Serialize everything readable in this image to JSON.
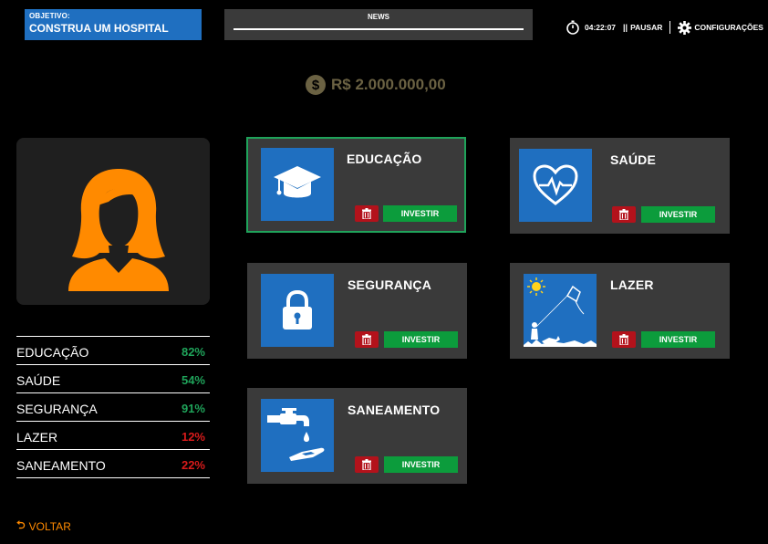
{
  "header": {
    "objective_label": "OBJETIVO:",
    "objective_value": "CONSTRUA UM HOSPITAL",
    "news_label": "NEWS",
    "timer": "04:22:07",
    "pause_label": "PAUSAR",
    "settings_label": "CONFIGURAÇÕES"
  },
  "money": {
    "amount": "R$ 2.000.000,00"
  },
  "stats": [
    {
      "label": "EDUCAÇÃO",
      "value": "82%",
      "color": "#1fa35a"
    },
    {
      "label": "SAÚDE",
      "value": "54%",
      "color": "#1fa35a"
    },
    {
      "label": "SEGURANÇA",
      "value": "91%",
      "color": "#1fa35a"
    },
    {
      "label": "LAZER",
      "value": "12%",
      "color": "#d81b1b"
    },
    {
      "label": "SANEAMENTO",
      "value": "22%",
      "color": "#d81b1b"
    }
  ],
  "back_label": "VOLTAR",
  "cards": [
    {
      "title": "EDUCAÇÃO",
      "icon": "graduation-cap-icon",
      "invest_label": "INVESTIR",
      "selected": true
    },
    {
      "title": "SAÚDE",
      "icon": "heart-pulse-icon",
      "invest_label": "INVESTIR",
      "selected": false
    },
    {
      "title": "SEGURANÇA",
      "icon": "lock-icon",
      "invest_label": "INVESTIR",
      "selected": false
    },
    {
      "title": "LAZER",
      "icon": "kite-icon",
      "invest_label": "INVESTIR",
      "selected": false
    },
    {
      "title": "SANEAMENTO",
      "icon": "water-tap-icon",
      "invest_label": "INVESTIR",
      "selected": false
    }
  ],
  "colors": {
    "accent_blue": "#1f6fc0",
    "invest_green": "#0c9c3c",
    "delete_red": "#b3121b",
    "avatar_orange": "#ff8a00",
    "money_gold": "#6b6243"
  }
}
